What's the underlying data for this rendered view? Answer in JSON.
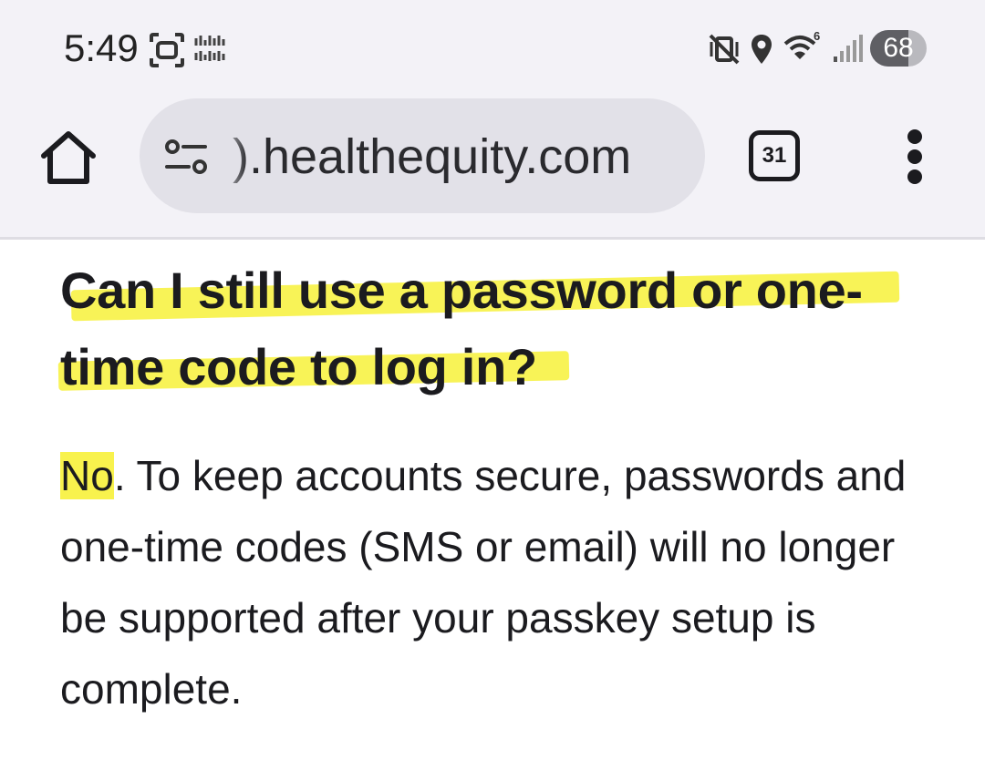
{
  "status_bar": {
    "time": "5:49",
    "battery_level": "68",
    "battery_fraction": 0.68,
    "wifi_generation": "6",
    "icons": [
      "screenshot-icon",
      "notification-icon",
      "vibrate-mute-icon",
      "location-icon",
      "wifi-icon",
      "signal-icon",
      "battery-icon"
    ]
  },
  "browser": {
    "url": ").healthequity.com",
    "tab_count": "31",
    "icons": [
      "home-icon",
      "site-settings-icon",
      "tab-switcher-icon",
      "more-options-icon"
    ]
  },
  "article": {
    "question": "Can I still use a password or one-time code to log in?",
    "answer_lead": "No",
    "answer_rest": ". To keep accounts secure, passwords and one-time codes (SMS or email) will no longer be supported after your passkey setup is complete.",
    "highlight_color": "#f7f13a"
  }
}
